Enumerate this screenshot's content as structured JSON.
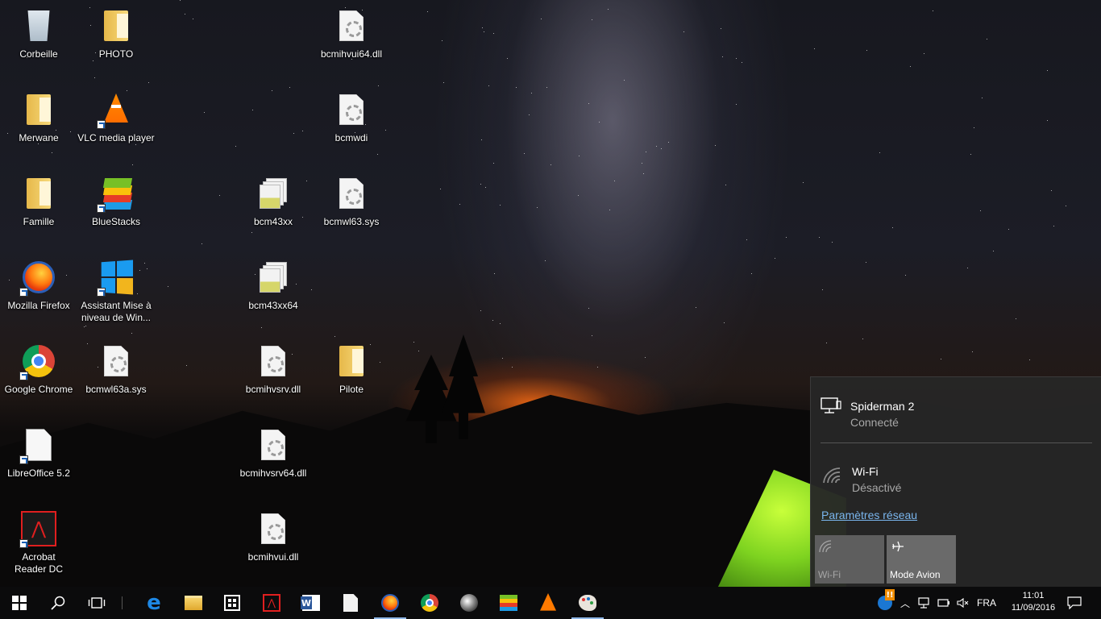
{
  "desktop": {
    "icons": {
      "corbeille": "Corbeille",
      "photo": "PHOTO",
      "bcmihvui64": "bcmihvui64.dll",
      "merwane": "Merwane",
      "vlc": "VLC media player",
      "bcmwdi": "bcmwdi",
      "famille": "Famille",
      "bluestacks": "BlueStacks",
      "bcm43xx": "bcm43xx",
      "bcmwl63": "bcmwl63.sys",
      "firefox": "Mozilla Firefox",
      "assistant": "Assistant Mise à niveau de Win...",
      "bcm43xx64": "bcm43xx64",
      "chrome": "Google Chrome",
      "bcmwl63a": "bcmwl63a.sys",
      "bcmihvsrv": "bcmihvsrv.dll",
      "pilote": "Pilote",
      "libreoffice": "LibreOffice 5.2",
      "bcmihvsrv64": "bcmihvsrv64.dll",
      "acrobat": "Acrobat Reader DC",
      "bcmihvui": "bcmihvui.dll"
    }
  },
  "flyout": {
    "ethernet": {
      "name": "Spiderman  2",
      "status": "Connecté",
      "icon": "ethernet-icon"
    },
    "wifi": {
      "name": "Wi-Fi",
      "status": "Désactivé",
      "icon": "wifi-icon"
    },
    "settings_link": "Paramètres réseau",
    "quick_actions": [
      {
        "label": "Wi-Fi",
        "icon": "wifi-icon",
        "state": "off"
      },
      {
        "label": "Mode Avion",
        "icon": "airplane-icon",
        "state": "on"
      }
    ]
  },
  "taskbar": {
    "apps": [
      "start-icon",
      "search-icon",
      "task-view-icon",
      "edge-icon",
      "file-explorer-icon",
      "store-icon",
      "acrobat-icon",
      "word-icon",
      "file-icon",
      "firefox-icon",
      "chrome-icon",
      "media-icon",
      "bluestacks-icon",
      "vlc-icon",
      "paint-icon"
    ],
    "tray": {
      "language": "FRA",
      "time": "11:01",
      "date": "11/09/2016"
    }
  },
  "colors": {
    "accent": "#7ab6ee",
    "flyout_bg": "#262626",
    "taskbar_bg": "#0b0b0c"
  }
}
